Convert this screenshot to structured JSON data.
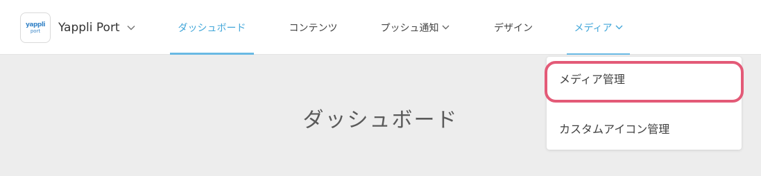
{
  "app": {
    "logo_top": "yappli",
    "logo_bottom": "port",
    "name": "Yappli Port"
  },
  "nav": {
    "dashboard": "ダッシュボード",
    "contents": "コンテンツ",
    "push": "プッシュ通知",
    "design": "デザイン",
    "media": "メディア"
  },
  "main": {
    "title": "ダッシュボード"
  },
  "dropdown": {
    "items": [
      "メディア管理",
      "カスタムアイコン管理"
    ]
  },
  "colors": {
    "accent": "#41a6d9",
    "highlight": "#e35a77",
    "background": "#ededed"
  }
}
